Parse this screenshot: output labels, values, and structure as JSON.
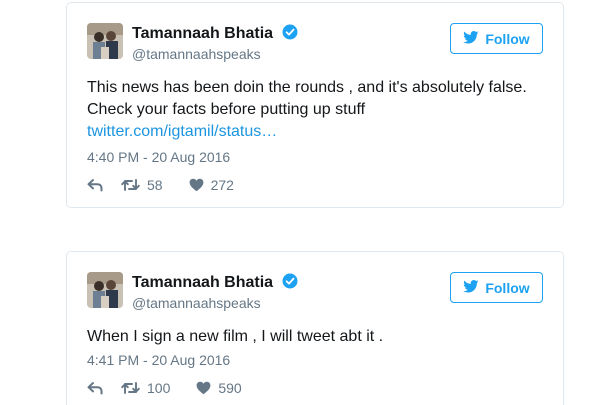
{
  "tweets": [
    {
      "author_name": "Tamannaah Bhatia",
      "handle": "@tamannaahspeaks",
      "follow_label": "Follow",
      "text": "This news has been doin the rounds , and it's absolutely false. Check your facts before putting up stuff",
      "link": "twitter.com/igtamil/status…",
      "timestamp": "4:40 PM - 20 Aug 2016",
      "retweets": "58",
      "likes": "272"
    },
    {
      "author_name": "Tamannaah Bhatia",
      "handle": "@tamannaahspeaks",
      "follow_label": "Follow",
      "text": "When I sign a new film , I will tweet abt it .",
      "timestamp": "4:41 PM - 20 Aug 2016",
      "retweets": "100",
      "likes": "590"
    }
  ],
  "icons": {
    "verified": "verified-badge-icon",
    "follow": "twitter-bird-icon",
    "reply": "reply-icon",
    "retweet": "retweet-icon",
    "like": "heart-icon"
  },
  "colors": {
    "accent": "#1da1f2",
    "link": "#1b95e0",
    "text": "#14171a",
    "muted": "#657786",
    "border": "#e1e8ed"
  }
}
